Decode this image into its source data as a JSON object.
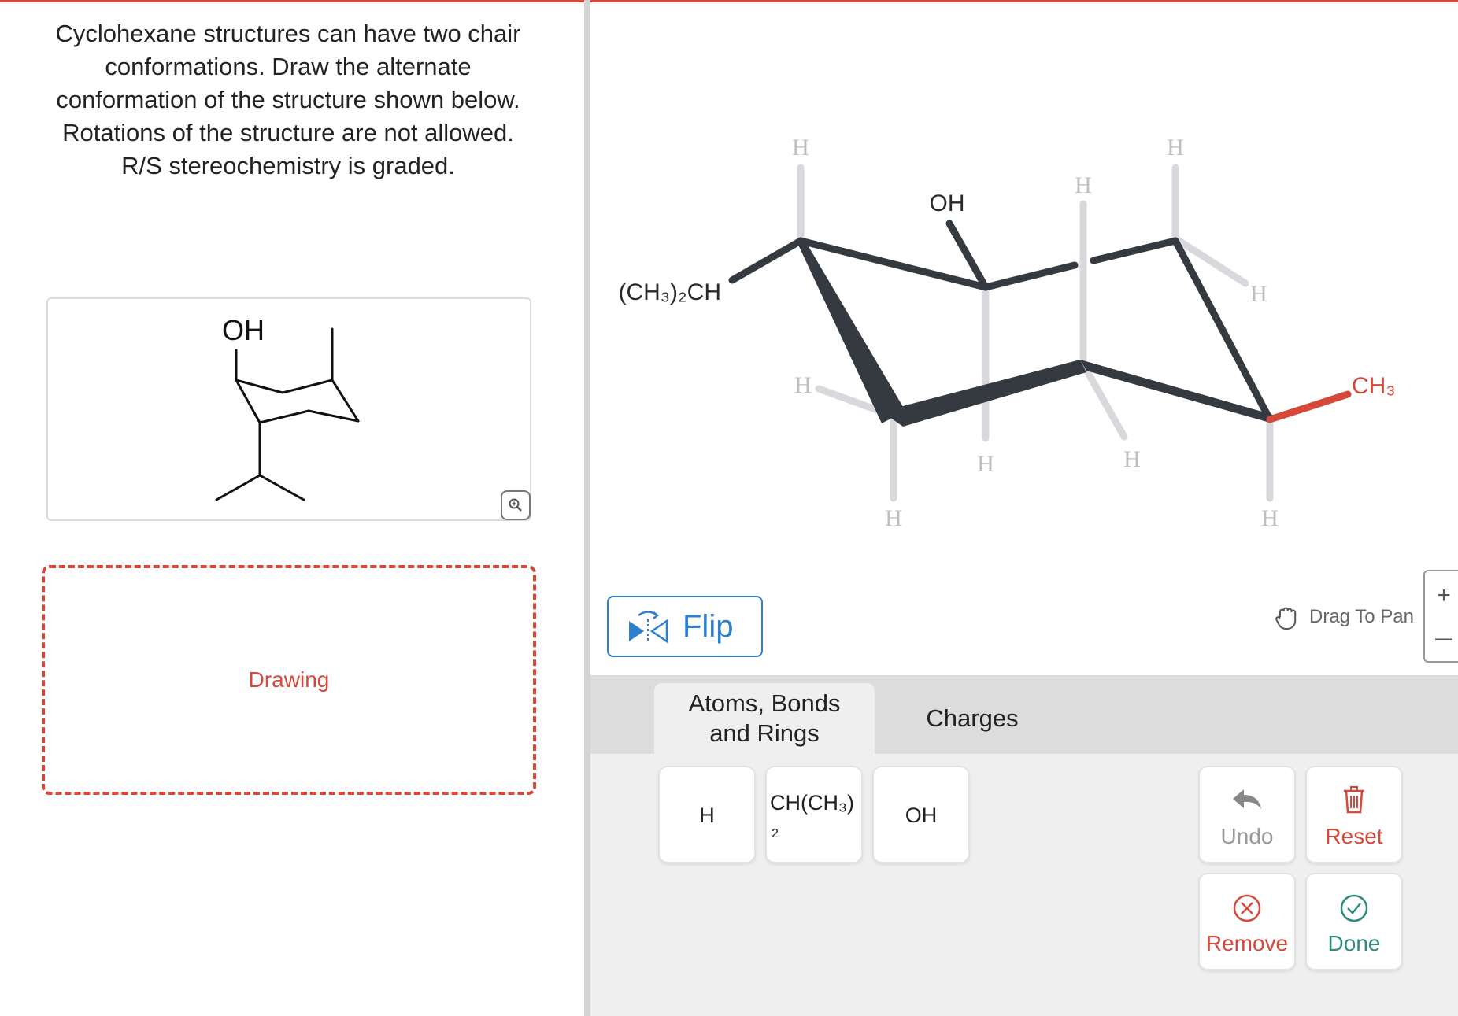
{
  "question": {
    "lines": [
      "Cyclohexane structures can have two chair",
      "conformations.  Draw the alternate",
      "conformation of the structure shown below.",
      "Rotations of the structure are not allowed.",
      "R/S stereochemistry is graded."
    ]
  },
  "reference": {
    "oh_label": "OH"
  },
  "answer": {
    "drawing_label": "Drawing"
  },
  "chair": {
    "top_oh": "OH",
    "left_group": "(CH₃)₂CH",
    "right_group": "CH₃",
    "h": "H"
  },
  "toolbar": {
    "flip_label": "Flip",
    "pan_label": "Drag To Pan",
    "zoom_in": "+",
    "zoom_out": "—"
  },
  "tabs": [
    {
      "label_line1": "Atoms, Bonds",
      "label_line2": "and Rings",
      "active": true
    },
    {
      "label": "Charges",
      "active": false
    }
  ],
  "keys": [
    {
      "label": "H"
    },
    {
      "label": "CH(CH₃)",
      "sub": "2"
    },
    {
      "label": "OH"
    }
  ],
  "actions": {
    "undo": "Undo",
    "reset": "Reset",
    "remove": "Remove",
    "done": "Done"
  },
  "colors": {
    "accent_red": "#d6493a",
    "accent_blue": "#2f7fcf",
    "done_teal": "#2e8b7a",
    "bond_dark": "#343a40",
    "bond_light": "#d9d9dd"
  }
}
